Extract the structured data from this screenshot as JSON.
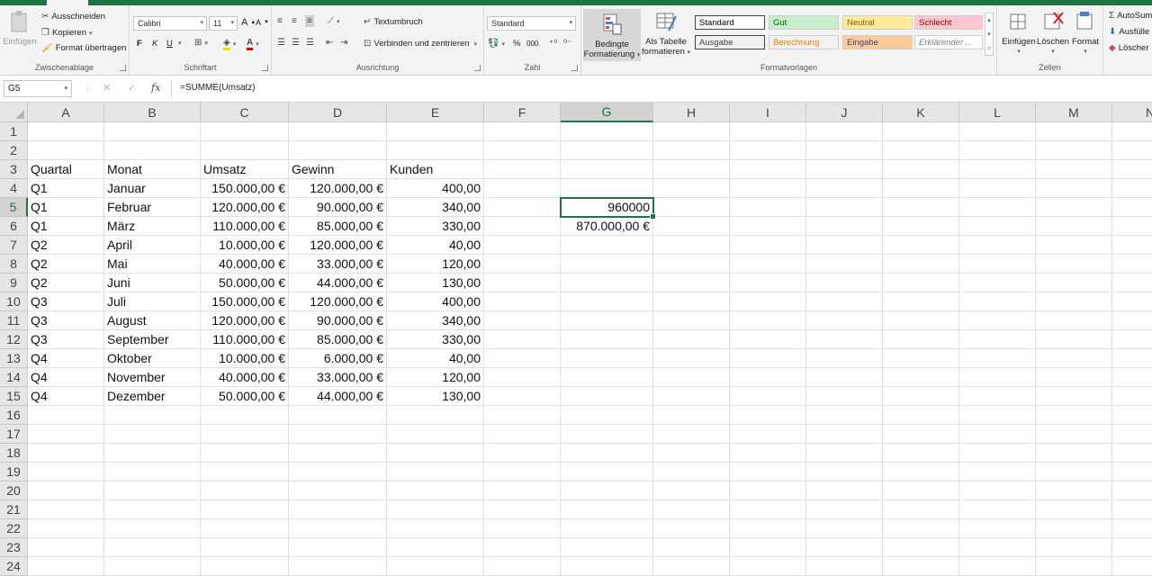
{
  "ribbon": {
    "clipboard": {
      "paste": "Einfügen",
      "cut": "Ausschneiden",
      "copy": "Kopieren",
      "format_painter": "Format übertragen",
      "label": "Zwischenablage"
    },
    "font": {
      "name": "Calibri",
      "size": "11",
      "bold": "F",
      "italic": "K",
      "underline": "U",
      "label": "Schriftart"
    },
    "alignment": {
      "wrap": "Textumbruch",
      "merge": "Verbinden und zentrieren",
      "label": "Ausrichtung"
    },
    "number": {
      "format": "Standard",
      "percent": "%",
      "thousands": "000",
      "label": "Zahl"
    },
    "conditional": {
      "line1": "Bedingte",
      "line2": "Formatierung"
    },
    "as_table": {
      "line1": "Als Tabelle",
      "line2": "formatieren"
    },
    "styles": {
      "items": [
        {
          "label": "Standard",
          "bg": "#ffffff",
          "fg": "#000000"
        },
        {
          "label": "Gut",
          "bg": "#c6efce",
          "fg": "#006100"
        },
        {
          "label": "Neutral",
          "bg": "#ffeb9c",
          "fg": "#9c5700"
        },
        {
          "label": "Schlecht",
          "bg": "#ffc7ce",
          "fg": "#9c0006"
        },
        {
          "label": "Ausgabe",
          "bg": "#f2f2f2",
          "fg": "#3f3f3f"
        },
        {
          "label": "Berechnung",
          "bg": "#f2f2f2",
          "fg": "#fa7d00"
        },
        {
          "label": "Eingabe",
          "bg": "#ffcc99",
          "fg": "#3f3f76"
        },
        {
          "label": "Erklärender ...",
          "bg": "#ffffff",
          "fg": "#7f7f7f"
        }
      ],
      "label": "Formatvorlagen"
    },
    "cells": {
      "insert": "Einfügen",
      "delete": "Löschen",
      "format": "Format",
      "label": "Zellen"
    },
    "editing": {
      "autosum": "AutoSum",
      "fill": "Ausfülle",
      "clear": "Löscher"
    }
  },
  "formula_bar": {
    "name_box": "G5",
    "formula": "=SUMME(Umsatz)",
    "fx": "fx"
  },
  "columns": [
    "A",
    "B",
    "C",
    "D",
    "E",
    "F",
    "G",
    "H",
    "I",
    "J",
    "K",
    "L",
    "M",
    "N"
  ],
  "selected_column": "G",
  "selected_row": 5,
  "rows": [
    1,
    2,
    3,
    4,
    5,
    6,
    7,
    8,
    9,
    10,
    11,
    12,
    13,
    14,
    15,
    16,
    17,
    18,
    19,
    20,
    21,
    22,
    23,
    24
  ],
  "table": {
    "header": [
      "Quartal",
      "Monat",
      "Umsatz",
      "Gewinn",
      "Kunden"
    ],
    "records": [
      [
        "Q1",
        "Januar",
        "150.000,00 €",
        "120.000,00 €",
        "400,00"
      ],
      [
        "Q1",
        "Februar",
        "120.000,00 €",
        "90.000,00 €",
        "340,00"
      ],
      [
        "Q1",
        "März",
        "110.000,00 €",
        "85.000,00 €",
        "330,00"
      ],
      [
        "Q2",
        "April",
        "10.000,00 €",
        "120.000,00 €",
        "40,00"
      ],
      [
        "Q2",
        "Mai",
        "40.000,00 €",
        "33.000,00 €",
        "120,00"
      ],
      [
        "Q2",
        "Juni",
        "50.000,00 €",
        "44.000,00 €",
        "130,00"
      ],
      [
        "Q3",
        "Juli",
        "150.000,00 €",
        "120.000,00 €",
        "400,00"
      ],
      [
        "Q3",
        "August",
        "120.000,00 €",
        "90.000,00 €",
        "340,00"
      ],
      [
        "Q3",
        "September",
        "110.000,00 €",
        "85.000,00 €",
        "330,00"
      ],
      [
        "Q4",
        "Oktober",
        "10.000,00 €",
        "6.000,00 €",
        "40,00"
      ],
      [
        "Q4",
        "November",
        "40.000,00 €",
        "33.000,00 €",
        "120,00"
      ],
      [
        "Q4",
        "Dezember",
        "50.000,00 €",
        "44.000,00 €",
        "130,00"
      ]
    ]
  },
  "results": {
    "g5": "960000",
    "g6": "870.000,00 €"
  },
  "colors": {
    "accent": "#217346"
  }
}
